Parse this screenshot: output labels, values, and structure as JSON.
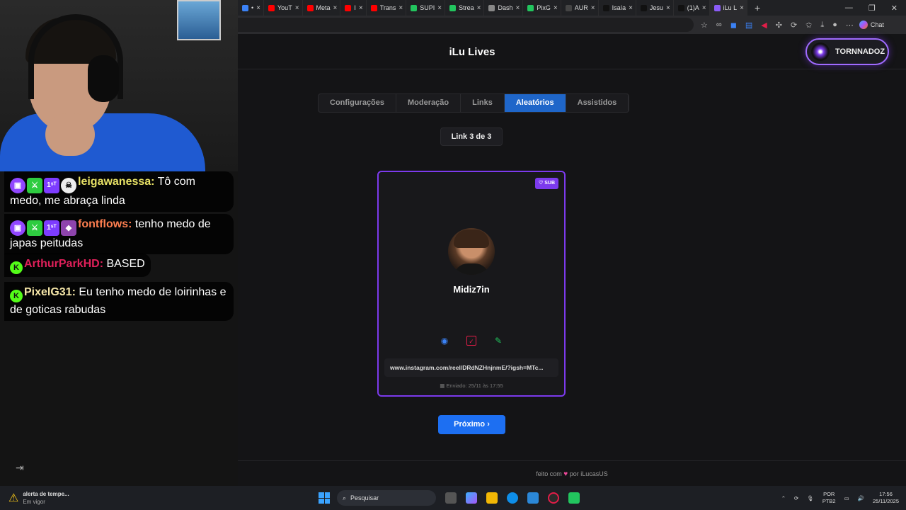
{
  "browser": {
    "tabs": [
      {
        "label": "•",
        "color": "#3b82f6"
      },
      {
        "label": "YouT",
        "color": "#ff0000"
      },
      {
        "label": "Meta",
        "color": "#ff0000"
      },
      {
        "label": "I",
        "color": "#ff0000"
      },
      {
        "label": "Trans",
        "color": "#ff0000"
      },
      {
        "label": "SUPI",
        "color": "#22c55e"
      },
      {
        "label": "Strea",
        "color": "#22c55e"
      },
      {
        "label": "Dash",
        "color": "#888888"
      },
      {
        "label": "PixG",
        "color": "#22c55e"
      },
      {
        "label": "AUR",
        "color": "#222222"
      },
      {
        "label": "Isaía",
        "color": "#111111"
      },
      {
        "label": "Jesu",
        "color": "#111111"
      },
      {
        "label": "(1)A",
        "color": "#111111"
      },
      {
        "label": "iLu L",
        "color": "#8b5cf6"
      }
    ],
    "chat_label": "Chat"
  },
  "stream_chat": {
    "messages": [
      {
        "user": "leigawanessa:",
        "user_color": "#e8e266",
        "text": " Tô com medo, me abraça linda"
      },
      {
        "user": "fontflows:",
        "user_color": "#ff7f50",
        "text": " tenho medo de japas peitudas"
      },
      {
        "user": "ArthurParkHD:",
        "user_color": "#e0205a",
        "text": " BASED"
      },
      {
        "user": "PixelG31:",
        "user_color": "#f5e6a8",
        "text": " Eu tenho medo de loirinhas e de goticas rabudas"
      }
    ]
  },
  "app": {
    "title": "iLu Lives",
    "user_name": "TORNNADOZ",
    "tabs": [
      "Configurações",
      "Moderação",
      "Links",
      "Aleatórios",
      "Assistidos"
    ],
    "active_tab": "Aleatórios",
    "counter": "Link 3 de 3",
    "card": {
      "badge": "♡ SUB",
      "name": "Midiz7in",
      "url": "www.instagram.com/reel/DRdNZHnjnmE/?igsh=MTc...",
      "sent": "Enviado: 25/11 às 17:55"
    },
    "next_label": "Próximo ›",
    "footer_pre": "feito com",
    "footer_heart": "♥",
    "footer_post": "por iLucasUS"
  },
  "taskbar": {
    "weather_title": "alerta de tempe...",
    "weather_sub": "Em vigor",
    "search_placeholder": "Pesquisar",
    "lang_top": "POR",
    "lang_bottom": "PTB2",
    "time": "17:56",
    "date": "25/11/2025"
  }
}
